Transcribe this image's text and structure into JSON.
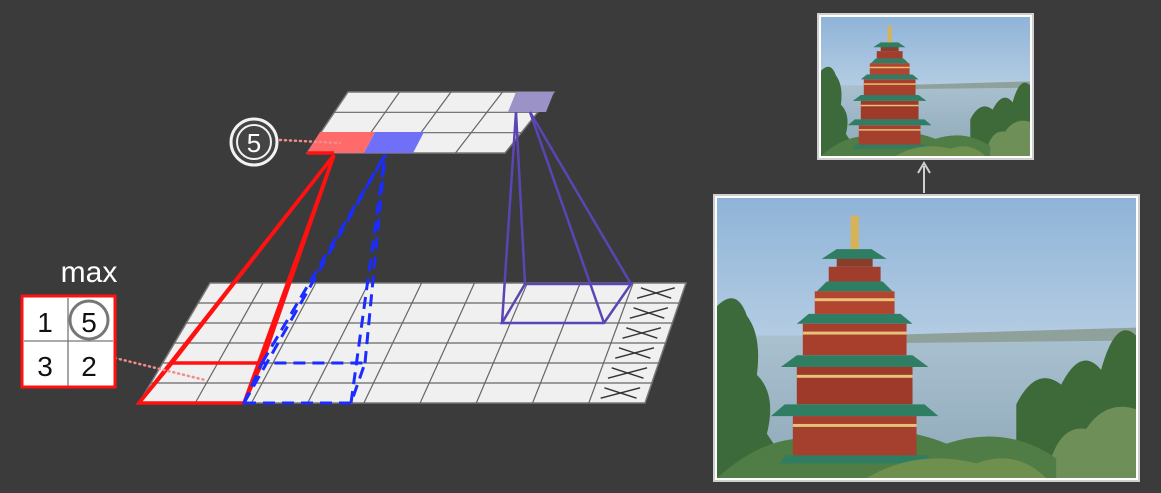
{
  "diagram": {
    "op_label": "max",
    "pool_window": [
      "1",
      "5",
      "3",
      "2"
    ],
    "pooled_value": "5"
  },
  "colors": {
    "background": "#3b3b3b",
    "grid_fill": "#f0f0f0",
    "grid_line": "#555555",
    "red": "#ff1111",
    "blue": "#1a2cff",
    "purple": "#6e55c0",
    "output_red_cell": "#ff6a6a",
    "output_blue_cell": "#6f6ff8",
    "output_purple_cell": "#9b92c8"
  },
  "images": {
    "large_photo_desc": "pagoda-photo-large",
    "small_photo_desc": "pagoda-photo-small"
  }
}
